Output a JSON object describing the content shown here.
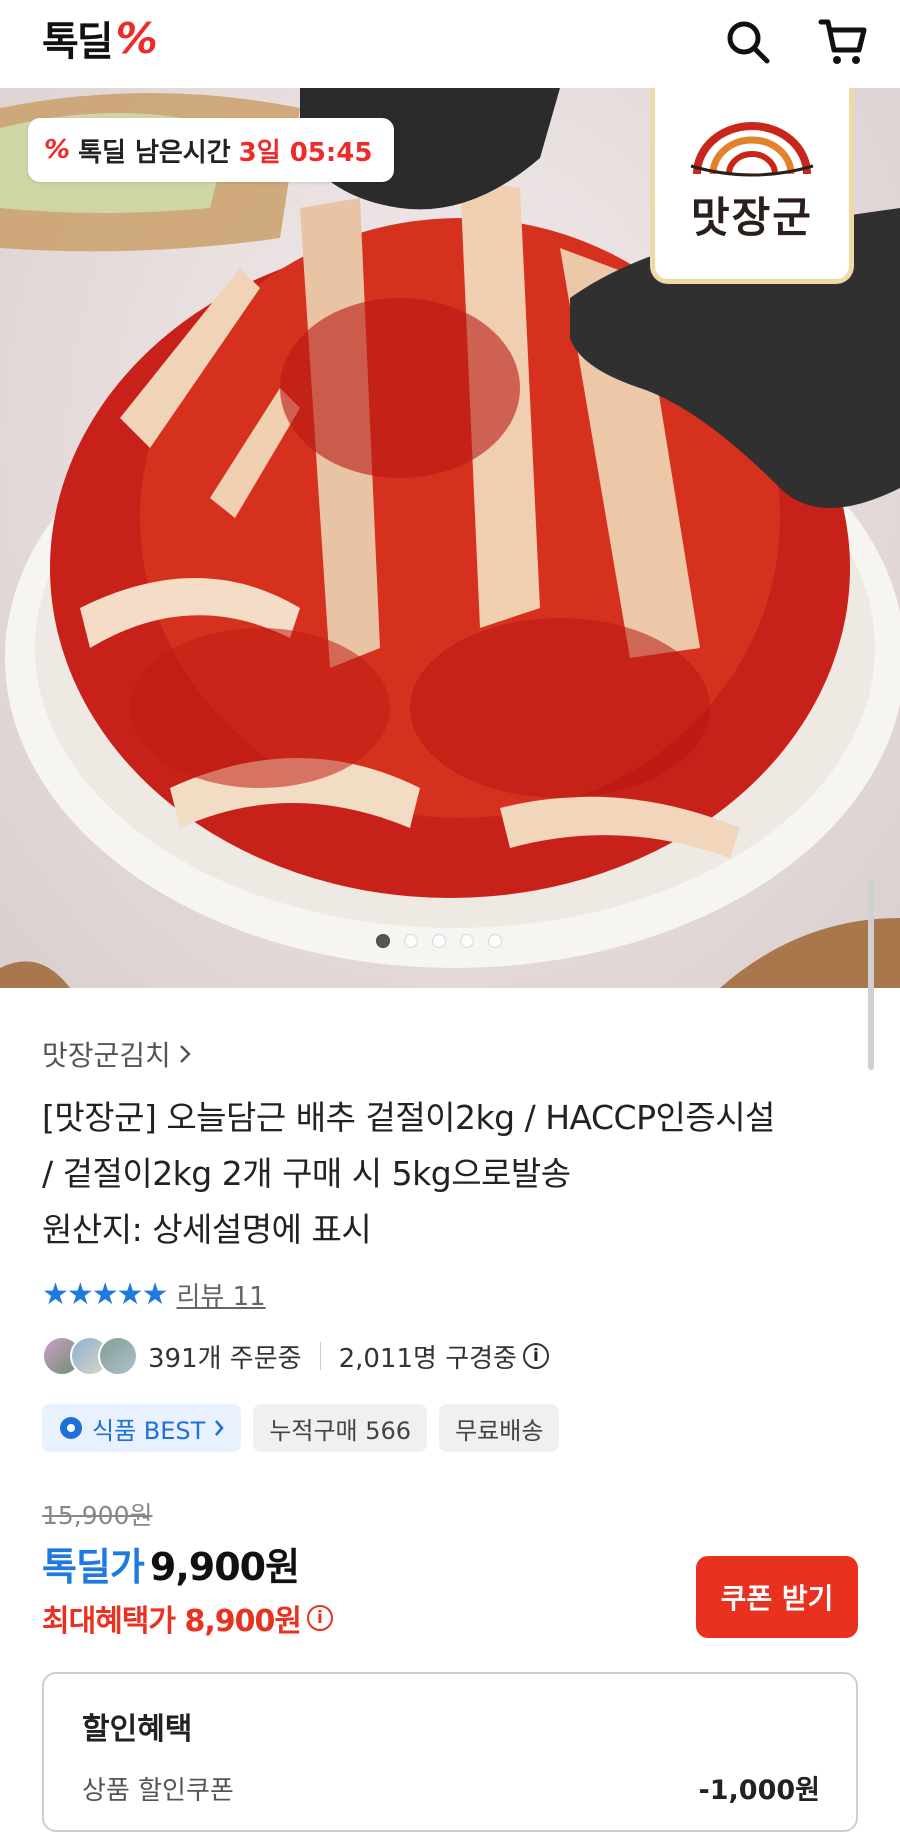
{
  "header": {
    "logo_text": "톡딜",
    "logo_mark": "%",
    "search_icon": "search-icon",
    "cart_icon": "cart-icon"
  },
  "hero": {
    "timer": {
      "label": "톡딜 남은시간",
      "remaining": "3일 05:45"
    },
    "brand_badge_text": "맛장군",
    "carousel": {
      "total": 5,
      "active_index": 0
    }
  },
  "product": {
    "seller": "맛장군김치",
    "title_lines": [
      "[맛장군] 오늘담근 배추 겉절이2kg / HACCP인증시설",
      "/ 겉절이2kg 2개 구매 시 5kg으로발송",
      "원산지: 상세설명에 표시"
    ],
    "rating": {
      "stars": 5,
      "max": 5,
      "review_label": "리뷰 11"
    },
    "stats": {
      "ordering": "391개 주문중",
      "watching": "2,011명 구경중"
    },
    "chips": {
      "best": "식품 BEST",
      "cumulative": "누적구매 566",
      "shipping": "무료배송"
    },
    "price": {
      "original": "15,900원",
      "deal_label": "톡딜가",
      "deal_price": "9,900원",
      "max_benefit": "최대혜택가 8,900원"
    },
    "coupon_button": "쿠폰 받기",
    "benefits": {
      "title": "할인혜택",
      "item_name": "상품 할인쿠폰",
      "item_value": "-1,000원"
    }
  },
  "colors": {
    "brand_red": "#e8321f",
    "deal_blue": "#1f7ae0"
  }
}
